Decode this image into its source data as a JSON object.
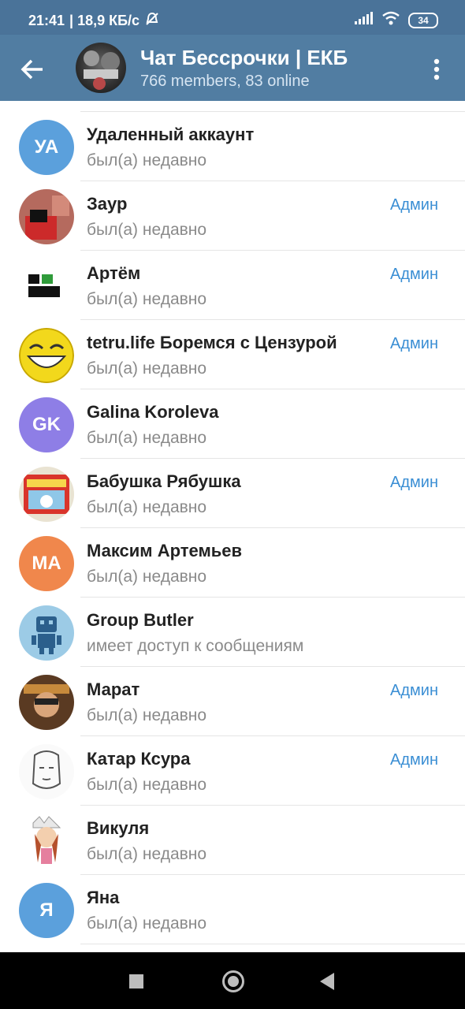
{
  "status_bar": {
    "time": "21:41",
    "speed": "| 18,9 КБ/с",
    "battery": "34",
    "icons": [
      "bell-off-icon",
      "signal-icon",
      "wifi-icon",
      "battery-icon"
    ]
  },
  "header": {
    "title": "Чат Бессрочки | ЕКБ",
    "subtitle": "766 members, 83 online",
    "back_icon": "arrow-left-icon",
    "menu_icon": "more-vertical-icon"
  },
  "colors": {
    "header_bg": "#517da2",
    "admin": "#3a8ed4",
    "avatar_blue": "#5ba0dc",
    "avatar_purple": "#8e7ee6",
    "avatar_orange": "#f0874c"
  },
  "members": [
    {
      "name": "Удаленный аккаунт",
      "status": "был(а) недавно",
      "admin": "",
      "initials": "УА",
      "avatar": "initials-blue"
    },
    {
      "name": "Заур",
      "status": "был(а) недавно",
      "admin": "Админ",
      "initials": "",
      "avatar": "photo-red"
    },
    {
      "name": "Артём",
      "status": "был(а) недавно",
      "admin": "Админ",
      "initials": "",
      "avatar": "logo-text"
    },
    {
      "name": "tetru.life Боремся с Цензурой",
      "status": "был(а) недавно",
      "admin": "Админ",
      "initials": "",
      "avatar": "smiley"
    },
    {
      "name": "Galina Koroleva",
      "status": "был(а) недавно",
      "admin": "",
      "initials": "GK",
      "avatar": "initials-purple"
    },
    {
      "name": "Бабушка Рябушка",
      "status": "был(а) недавно",
      "admin": "Админ",
      "initials": "",
      "avatar": "photo-package"
    },
    {
      "name": "Максим Артемьев",
      "status": "был(а) недавно",
      "admin": "",
      "initials": "MA",
      "avatar": "initials-orange"
    },
    {
      "name": "Group Butler",
      "status": "имеет доступ к сообщениям",
      "admin": "",
      "initials": "",
      "avatar": "robot"
    },
    {
      "name": "Марат",
      "status": "был(а) недавно",
      "admin": "Админ",
      "initials": "",
      "avatar": "photo-portrait"
    },
    {
      "name": "Катар Ксура",
      "status": "был(а) недавно",
      "admin": "Админ",
      "initials": "",
      "avatar": "sketch"
    },
    {
      "name": "Викуля",
      "status": "был(а) недавно",
      "admin": "",
      "initials": "",
      "avatar": "cartoon-girl"
    },
    {
      "name": "Яна",
      "status": "был(а) недавно",
      "admin": "",
      "initials": "Я",
      "avatar": "initials-blue"
    }
  ],
  "nav": {
    "icons": [
      "recent-apps-icon",
      "home-icon",
      "back-triangle-icon"
    ]
  }
}
